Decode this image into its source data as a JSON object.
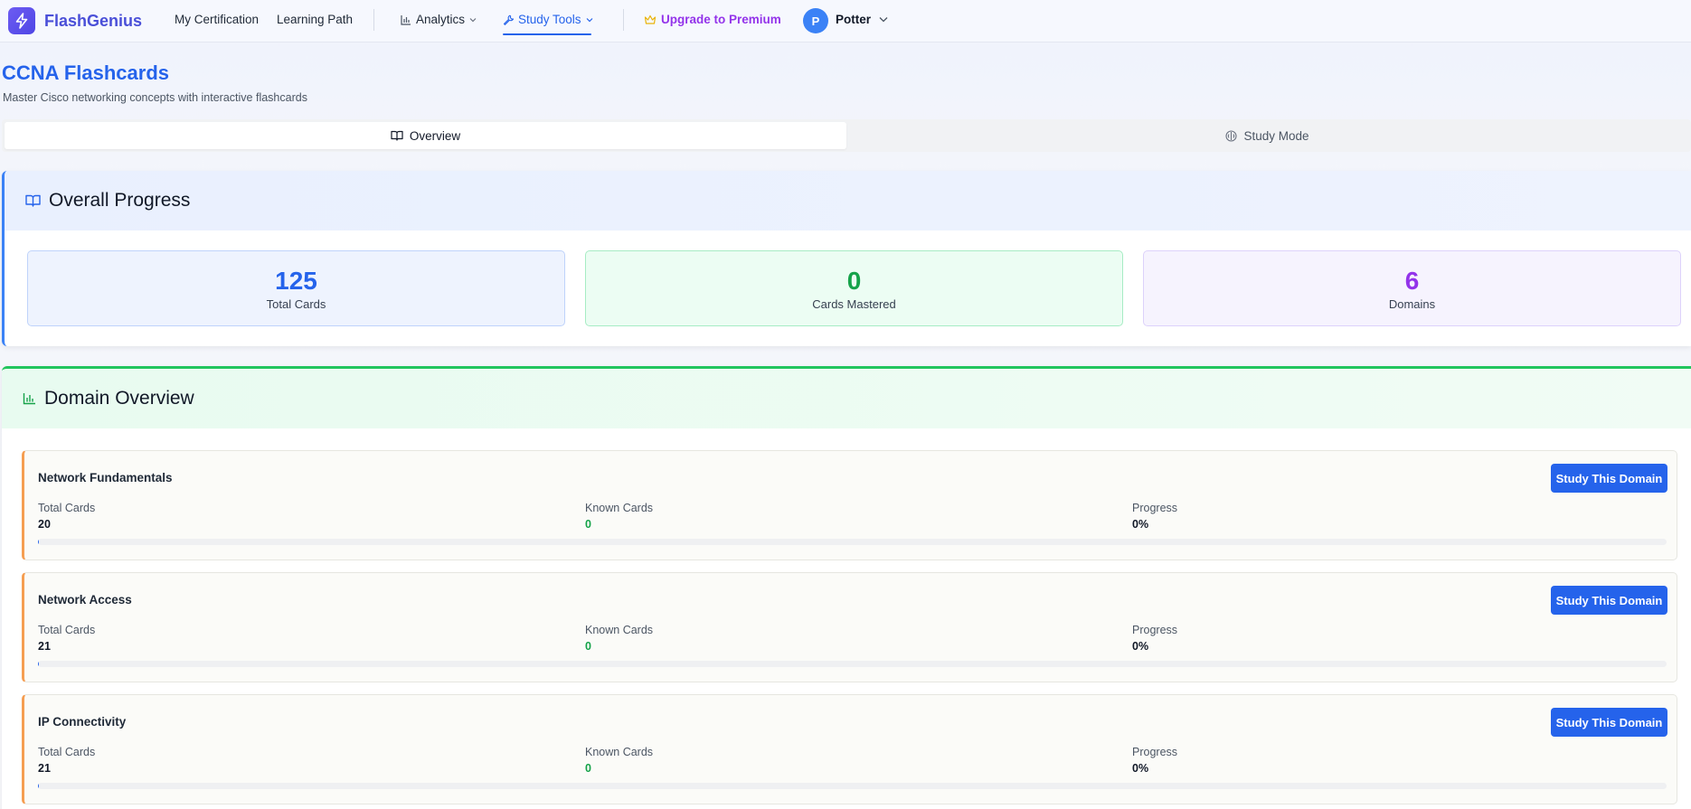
{
  "nav": {
    "brand": "FlashGenius",
    "links": {
      "my_certification": "My Certification",
      "learning_path": "Learning Path",
      "analytics": "Analytics",
      "study_tools": "Study Tools",
      "upgrade": "Upgrade to Premium"
    },
    "user": {
      "initial": "P",
      "name": "Potter"
    }
  },
  "header": {
    "title": "CCNA Flashcards",
    "subtitle": "Master Cisco networking concepts with interactive flashcards"
  },
  "tabs": {
    "overview": "Overview",
    "study_mode": "Study Mode",
    "active": "overview"
  },
  "overall_progress": {
    "title": "Overall Progress",
    "stats": {
      "total": {
        "value": "125",
        "label": "Total Cards"
      },
      "mastered": {
        "value": "0",
        "label": "Cards Mastered"
      },
      "domains": {
        "value": "6",
        "label": "Domains"
      }
    }
  },
  "domain_overview": {
    "title": "Domain Overview",
    "button_label": "Study This Domain",
    "col_labels": {
      "total": "Total Cards",
      "known": "Known Cards",
      "progress": "Progress"
    },
    "domains": [
      {
        "name": "Network Fundamentals",
        "total": "20",
        "known": "0",
        "progress": "0%",
        "progress_fraction": 0
      },
      {
        "name": "Network Access",
        "total": "21",
        "known": "0",
        "progress": "0%",
        "progress_fraction": 0
      },
      {
        "name": "IP Connectivity",
        "total": "21",
        "known": "0",
        "progress": "0%",
        "progress_fraction": 0
      }
    ]
  },
  "colors": {
    "primary": "#2563eb",
    "success": "#16a34a",
    "purple": "#9333ea",
    "domain_accent": "#f59e52"
  }
}
